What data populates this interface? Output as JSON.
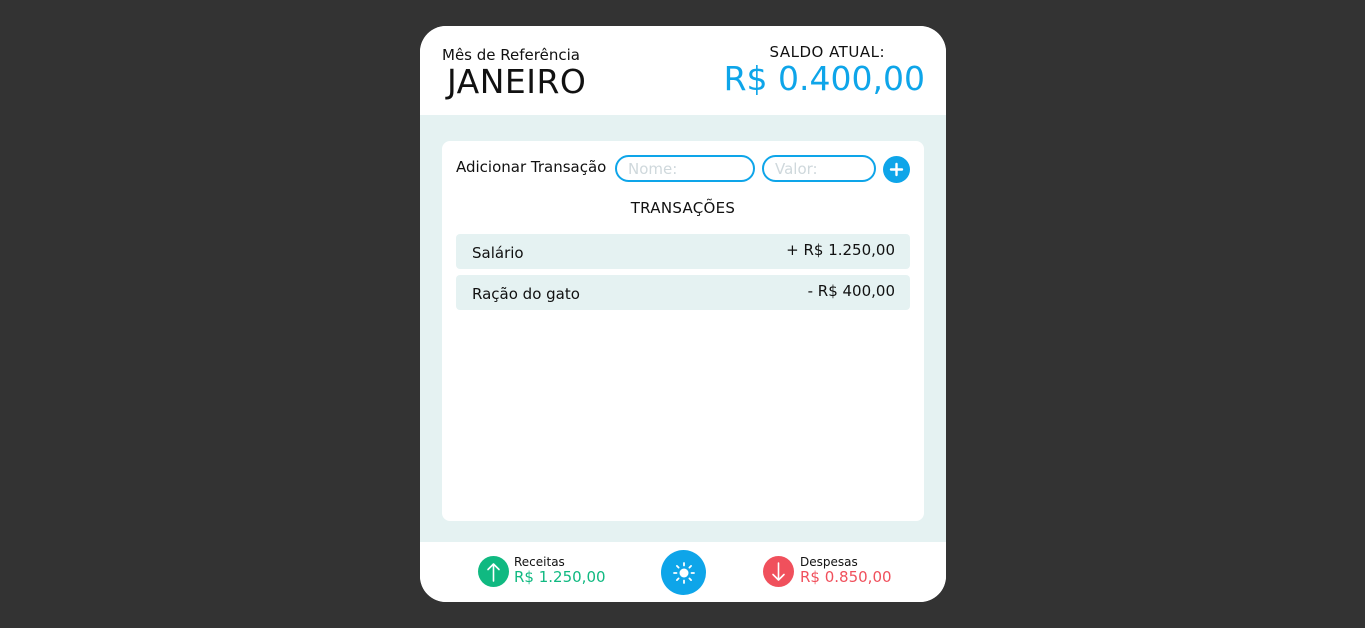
{
  "header": {
    "month_label": "Mês de Referência",
    "month_value": "JANEIRO",
    "balance_label": "SALDO ATUAL:",
    "balance_value": "R$ 0.400,00"
  },
  "form": {
    "label": "Adicionar Transação",
    "name_placeholder": "Nome:",
    "value_placeholder": "Valor:",
    "add_icon": "plus-icon"
  },
  "transactions": {
    "title": "TRANSAÇÕES",
    "items": [
      {
        "name": "Salário",
        "amount": "+ R$ 1.250,00"
      },
      {
        "name": "Ração do gato",
        "amount": "- R$ 400,00"
      }
    ]
  },
  "footer": {
    "income_label": "Receitas",
    "income_value": "R$ 1.250,00",
    "expense_label": "Despesas",
    "expense_value": "R$ 0.850,00",
    "theme_icon": "sun-icon"
  },
  "colors": {
    "accent": "#0ea5e9",
    "income": "#10b981",
    "expense": "#f0505c",
    "background": "#333333",
    "panel": "#e5f2f2"
  }
}
